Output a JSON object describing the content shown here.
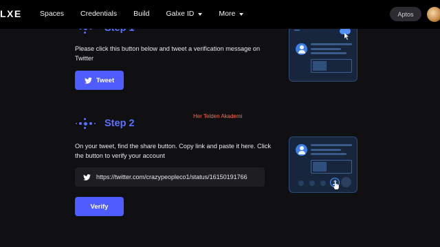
{
  "header": {
    "logo": "LXE",
    "nav": [
      {
        "label": "Spaces",
        "dropdown": false
      },
      {
        "label": "Credentials",
        "dropdown": false
      },
      {
        "label": "Build",
        "dropdown": false
      },
      {
        "label": "Galxe ID",
        "dropdown": true
      },
      {
        "label": "More",
        "dropdown": true
      }
    ],
    "chain": "Aptos"
  },
  "step1": {
    "title": "Step 1",
    "description": "Please click this button below and tweet a verification message on Twitter",
    "button": "Tweet"
  },
  "step2": {
    "title": "Step 2",
    "description": "On your tweet, find the share button. Copy link and paste it here. Click the button to verify your account",
    "link": "https://twitter.com/crazypeopleco1/status/16150191766",
    "button": "Verify"
  },
  "watermark": "Her Telden Akademi",
  "colors": {
    "accent": "#4f5dff",
    "step_title": "#5b72ff",
    "background": "#101012",
    "watermark": "#ff6a4a"
  }
}
